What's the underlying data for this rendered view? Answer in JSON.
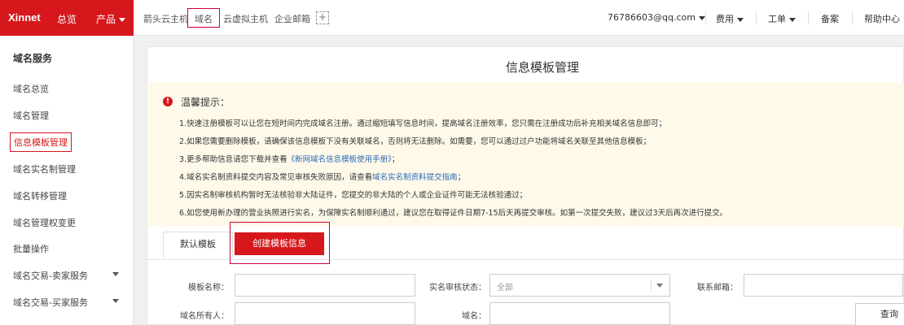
{
  "brand": {
    "logo": "Xinnet",
    "accent": "#d6171c",
    "link_color": "#2a6ab8",
    "notice_bg": "#fff9ea"
  },
  "topnav": {
    "overview": "总览",
    "products": "产品",
    "subnav": [
      "箭头云主机",
      "域名",
      "云虚拟主机",
      "企业邮箱"
    ],
    "plus_icon": "+",
    "user": "76786603@qq.com",
    "fee": "费用",
    "ticket": "工单",
    "record": "备案",
    "help": "帮助中心"
  },
  "sidebar": {
    "title": "域名服务",
    "items": [
      {
        "label": "域名总览"
      },
      {
        "label": "域名管理"
      },
      {
        "label": "信息模板管理",
        "active": true
      },
      {
        "label": "域名实名制管理"
      },
      {
        "label": "域名转移管理"
      },
      {
        "label": "域名管理权变更"
      },
      {
        "label": "批量操作"
      },
      {
        "label": "域名交易-卖家服务",
        "expandable": true
      },
      {
        "label": "域名交易-买家服务",
        "expandable": true
      }
    ]
  },
  "main": {
    "title": "信息模板管理",
    "notice": {
      "icon": "warning-icon",
      "title": "温馨提示：",
      "tips": [
        {
          "text": "1.快速注册模板可以让您在短时间内完成域名注册。通过缩短填写信息时间，提高域名注册效率，您只需在注册成功后补充相关域名信息即可；"
        },
        {
          "text": "2.如果您需要删除模板，请确保该信息模板下没有关联域名，否则将无法删除。如需要，您可以通过过户功能将域名关联至其他信息模板；"
        },
        {
          "text": "3.更多帮助信息请您下载并查看",
          "link": "《新网域名信息模板使用手册》",
          "after": "；"
        },
        {
          "text": "4.域名实名制资料提交内容及常见审核失败原因，请查看",
          "link": "域名实名制资料提交指南",
          "after": "；"
        },
        {
          "text": "5.因实名制审核机构暂时无法核验非大陆证件，您提交的非大陆的个人或企业证件可能无法核验通过；"
        },
        {
          "text": "6.如您使用新办理的营业执照进行实名，为保障实名制顺利通过，建议您在取得证件日期7-15后天再提交审核。如第一次提交失败，建议过3天后再次进行提交。"
        }
      ]
    },
    "tabs": {
      "default": "默认模板",
      "create": "创建模板信息"
    },
    "filters": {
      "template_name": {
        "label": "模板名称：",
        "value": ""
      },
      "verify_status": {
        "label": "实名审核状态：",
        "value": "全部"
      },
      "email": {
        "label": "联系邮箱：",
        "value": ""
      },
      "owner": {
        "label": "域名所有人：",
        "value": ""
      },
      "domain": {
        "label": "域名：",
        "value": ""
      },
      "query": "查询"
    }
  }
}
